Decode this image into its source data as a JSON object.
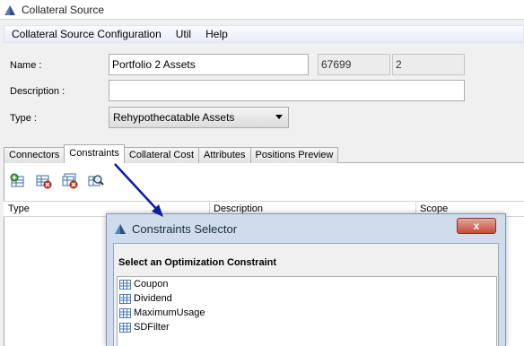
{
  "window": {
    "title": "Collateral Source"
  },
  "menu": {
    "items": [
      "Collateral Source Configuration",
      "Util",
      "Help"
    ]
  },
  "form": {
    "name_label": "Name :",
    "name_value": "Portfolio 2 Assets",
    "id_value": "67699",
    "version_value": "2",
    "description_label": "Description :",
    "description_value": "",
    "type_label": "Type :",
    "type_value": "Rehypothecatable Assets"
  },
  "tabs": [
    "Connectors",
    "Constraints",
    "Collateral Cost",
    "Attributes",
    "Positions Preview"
  ],
  "active_tab": "Constraints",
  "toolbar": {
    "icons": [
      "add-constraint-icon",
      "remove-constraint-icon",
      "remove-all-constraints-icon",
      "inspect-constraint-icon"
    ]
  },
  "grid": {
    "columns": [
      "Type",
      "Description",
      "Scope"
    ]
  },
  "dialog": {
    "title": "Constraints Selector",
    "close_label": "x",
    "heading": "Select an Optimization Constraint",
    "items": [
      "Coupon",
      "Dividend",
      "MaximumUsage",
      "SDFilter"
    ]
  },
  "colors": {
    "menubar": "#e8ecf7",
    "dialog_frame": "#cfdcec",
    "close_button": "#c74b3a",
    "annotation_arrow": "#0a1e9e"
  }
}
